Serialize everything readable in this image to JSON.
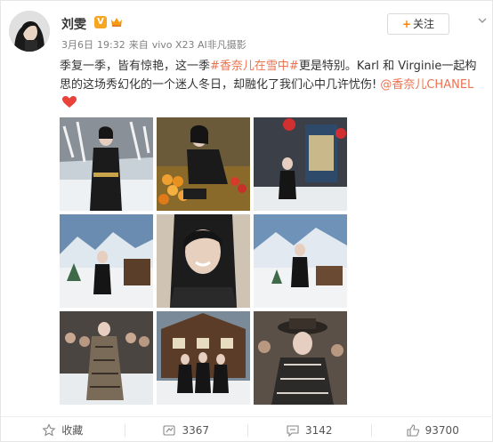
{
  "author": {
    "name": "刘雯",
    "verified_badge": "V"
  },
  "follow_button": {
    "plus": "+",
    "label": "关注"
  },
  "meta": {
    "date": "3月6日",
    "time": "19:32",
    "source_prefix": "来自",
    "source": "vivo X23 AI非凡摄影"
  },
  "post": {
    "text_1": "季复一季，皆有惊艳，这一季",
    "topic": "#香奈儿在雪中#",
    "text_2": "更是特别。Karl 和 Virginie一起构思的这场秀幻化的一个迷人冬日，却融化了我们心中几许忧伤! ",
    "mention": "@香奈儿CHANEL"
  },
  "gallery": {
    "images": [
      {
        "subject": "model in black tweed dress in snowy forest"
      },
      {
        "subject": "model at fruit market stall"
      },
      {
        "subject": "model by snowy chalet signs"
      },
      {
        "subject": "model on snowy runway with mountains"
      },
      {
        "subject": "close-up portrait smiling"
      },
      {
        "subject": "model standing on snowy set with mountain backdrop"
      },
      {
        "subject": "runway model in tweed coat"
      },
      {
        "subject": "models in front of chalet"
      },
      {
        "subject": "model in tweed hat"
      }
    ]
  },
  "actions": {
    "favorite_label": "收藏",
    "repost_count": "3367",
    "comment_count": "3142",
    "like_count": "93700"
  },
  "colors": {
    "link": "#eb7350",
    "follow_plus": "#ff8200",
    "verified": "#f5a623",
    "heart": "#e8423b"
  },
  "icons": {
    "favorite": "star-icon",
    "repost": "repost-icon",
    "comment": "comment-icon",
    "like": "thumbs-up-icon",
    "menu": "chevron-down-icon",
    "emoji": "heart-icon"
  }
}
